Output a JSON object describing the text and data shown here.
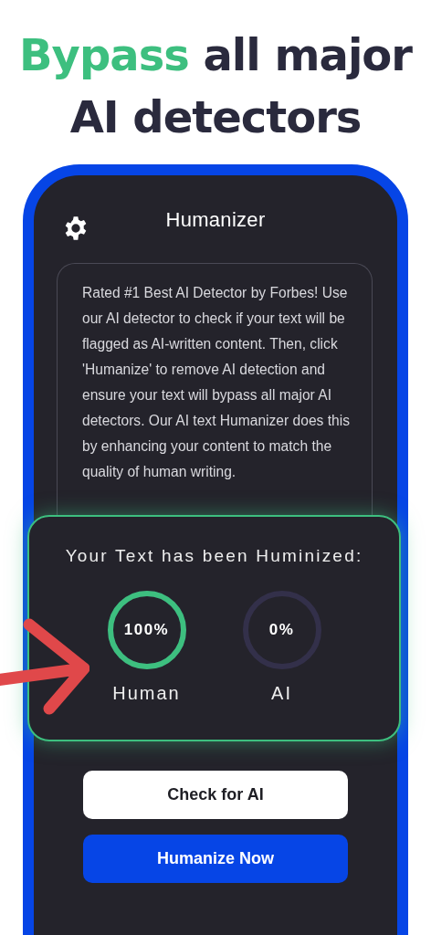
{
  "headline": {
    "highlight": "Bypass",
    "rest": "all major AI detectors"
  },
  "app": {
    "title": "Humanizer",
    "description": "Rated #1 Best AI Detector by Forbes! Use our AI detector to check if your text will be flagged as AI-written content. Then, click 'Humanize' to remove AI detection and ensure your text will bypass all major AI detectors. Our AI text Humanizer does this by enhancing your content to match the quality of human writing."
  },
  "result": {
    "title": "Your Text has been Huminized:",
    "scores": [
      {
        "value": "100%",
        "label": "Human",
        "level": 1
      },
      {
        "value": "0%",
        "label": "AI",
        "level": 0
      }
    ]
  },
  "buttons": [
    {
      "label": "Check for AI",
      "kind": "secondary"
    },
    {
      "label": "Humanize Now",
      "kind": "primary"
    }
  ]
}
